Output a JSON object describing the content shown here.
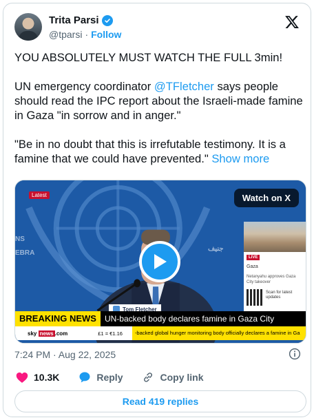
{
  "author": {
    "display_name": "Trita Parsi",
    "handle": "@tparsi",
    "separator": "·",
    "follow_label": "Follow"
  },
  "tweet": {
    "line1": "YOU ABSOLUTELY MUST WATCH THE FULL 3min!",
    "p2_pre": "UN emergency coordinator ",
    "p2_mention": "@TFletcher",
    "p2_post": " says people should read the IPC report about the Israeli-made famine in Gaza \"in sorrow and in anger.\"",
    "p3": "\"Be in no doubt that this is irrefutable testimony. It is a famine that we could have prevented.\" ",
    "show_more": "Show more"
  },
  "video": {
    "watch_on_x": "Watch on X",
    "latest_badge": "Latest",
    "un_text_left_top": "NS",
    "un_text_left_bottom": "EBRA",
    "un_text_right": "جنيف",
    "nameplate": "Tom Fletcher",
    "breaking_label": "BREAKING NEWS",
    "breaking_headline": "UN-backed body declares famine in Gaza City",
    "sky_logo_a": "sky ",
    "sky_logo_b": "news",
    "sky_logo_c": ".com",
    "ticker_rate": "£1 = €1.16",
    "ticker_text": "-backed global hunger monitoring body officially declares a famine in Ga",
    "side_live": "LIVE",
    "side_place": "Gaza",
    "side_headline": "Netanyahu approves Gaza City takeover",
    "side_qr_text": "Scan for latest updates"
  },
  "meta": {
    "timestamp": "7:24 PM · Aug 22, 2025"
  },
  "actions": {
    "like_count": "10.3K",
    "reply_label": "Reply",
    "copy_link_label": "Copy link"
  },
  "replies_button": "Read 419 replies",
  "colors": {
    "accent": "#1d9bf0",
    "like": "#f91880",
    "text": "#0f1419",
    "muted": "#536471",
    "border": "#cfd9de"
  }
}
